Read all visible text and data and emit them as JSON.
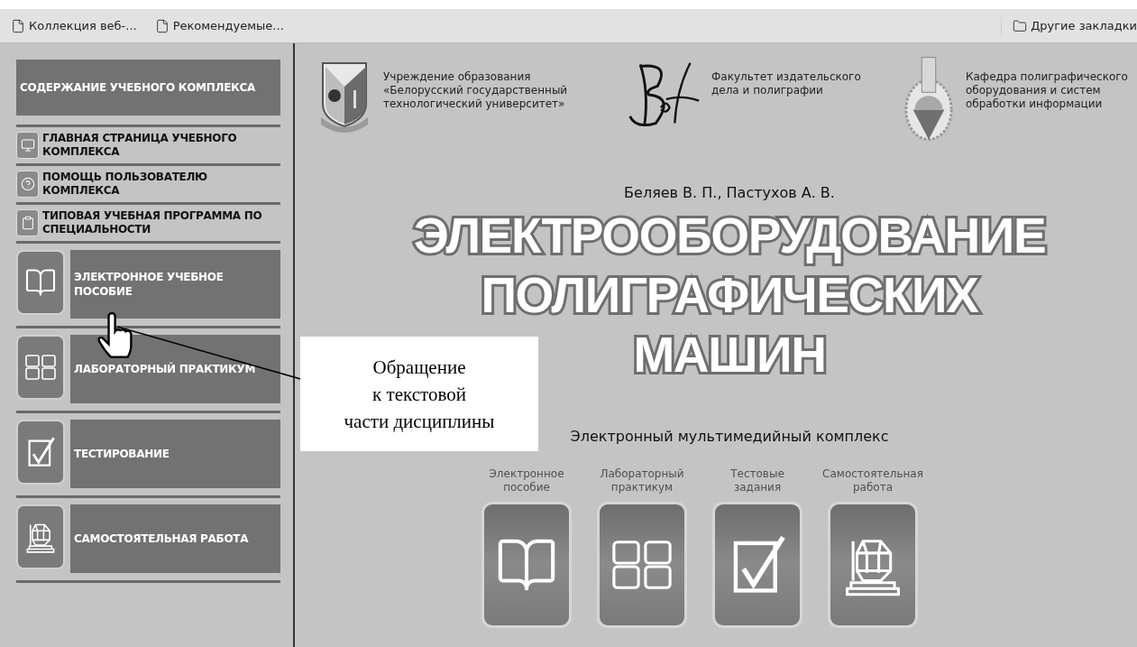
{
  "bookmarks_bar": {
    "items": [
      "Коллекция веб-...",
      "Рекомендуемые..."
    ],
    "other": "Другие закладки"
  },
  "sidebar": {
    "header": "СОДЕРЖАНИЕ УЧЕБНОГО КОМПЛЕКСА",
    "items": [
      {
        "kind": "small",
        "label": "ГЛАВНАЯ СТРАНИЦА УЧЕБНОГО КОМПЛЕКСА"
      },
      {
        "kind": "small",
        "label": "ПОМОЩЬ ПОЛЬЗОВАТЕЛЮ КОМПЛЕКСА"
      },
      {
        "kind": "small",
        "label": "ТИПОВАЯ УЧЕБНАЯ ПРОГРАММА ПО СПЕЦИАЛЬНОСТИ"
      },
      {
        "kind": "large",
        "label": "ЭЛЕКТРОННОЕ УЧЕБНОЕ ПОСОБИЕ"
      },
      {
        "kind": "large",
        "label": "ЛАБОРАТОРНЫЙ ПРАКТИКУМ"
      },
      {
        "kind": "large",
        "label": "ТЕСТИРОВАНИЕ"
      },
      {
        "kind": "large",
        "label": "САМОСТОЯТЕЛЬНАЯ РАБОТА"
      }
    ]
  },
  "header_institutions": [
    "Учреждение образования «Белорусский государственный технологический университет»",
    "Факультет издательского дела и полиграфии",
    "Кафедра полиграфического оборудования и систем обработки информации"
  ],
  "authors": "Беляев В. П., Пастухов А. В.",
  "title_lines": [
    "ЭЛЕКТРООБОРУДОВАНИЕ",
    "ПОЛИГРАФИЧЕСКИХ",
    "МАШИН"
  ],
  "subtitle": "Электронный мультимедийный комплекс",
  "tiles": [
    "Электронное пособие",
    "Лабораторный практикум",
    "Тестовые задания",
    "Самостоятельная работа"
  ],
  "callout": "Обращение\nк текстовой\nчасти дисциплины"
}
